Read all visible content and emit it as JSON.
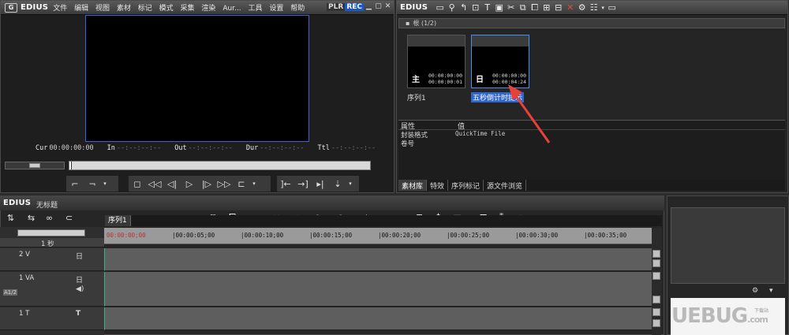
{
  "player": {
    "brand": "EDIUS",
    "menu": [
      "文件",
      "编辑",
      "视图",
      "素材",
      "标记",
      "模式",
      "采集",
      "渲染",
      "Aur...",
      "工具",
      "设置",
      "帮助"
    ],
    "plr": "PLR",
    "rec": "REC",
    "timecodes": [
      {
        "label": "Cur",
        "value": "00:00:00:00",
        "dim": false
      },
      {
        "label": "In",
        "value": "--:--:--:--",
        "dim": true
      },
      {
        "label": "Out",
        "value": "--:--:--:--",
        "dim": true
      },
      {
        "label": "Dur",
        "value": "--:--:--:--",
        "dim": true
      },
      {
        "label": "Ttl",
        "value": "--:--:--:--",
        "dim": true
      }
    ]
  },
  "bin": {
    "brand": "EDIUS",
    "folder": "根 (1/2)",
    "clips": [
      {
        "name": "序列1",
        "icon": "主",
        "tc1": "00:00:00:00",
        "tc2": "00:00:00:01",
        "selected": false
      },
      {
        "name": "五秒倒计时提示",
        "icon": "日",
        "tc1": "00:00:00:00",
        "tc2": "00:00:04:24",
        "selected": true
      }
    ],
    "props": {
      "col_attr": "属性",
      "col_value": "值",
      "rows": [
        {
          "key": "封装格式",
          "value": "QuickTime File"
        },
        {
          "key": "卷号",
          "value": ""
        }
      ]
    },
    "tabs": [
      "素材库",
      "特效",
      "序列标记",
      "源文件浏览"
    ]
  },
  "timeline": {
    "brand": "EDIUS",
    "project": "无标题",
    "sequence_tab": "序列1",
    "scale": "1 秒",
    "ruler": [
      "00:00:00;00",
      "|00:00:05;00",
      "|00:00:10;00",
      "|00:00:15;00",
      "|00:00:20;00",
      "|00:00:25;00",
      "|00:00:30;00",
      "|00:00:35;00"
    ],
    "tracks": [
      {
        "name": "2 V"
      },
      {
        "name": "1 VA"
      },
      {
        "name": "1 T"
      }
    ],
    "a12": "A1/2"
  },
  "side": {
    "watermark": "UEBUG",
    "watermark_suffix": ".com",
    "watermark_sub": "下载站"
  },
  "colors": {
    "rec_blue": "#1a58c8",
    "selection_blue": "#2f66d0",
    "screen_border": "#3565d8",
    "arrow_red": "#e8413a",
    "lane_edge": "#3bb08d"
  }
}
